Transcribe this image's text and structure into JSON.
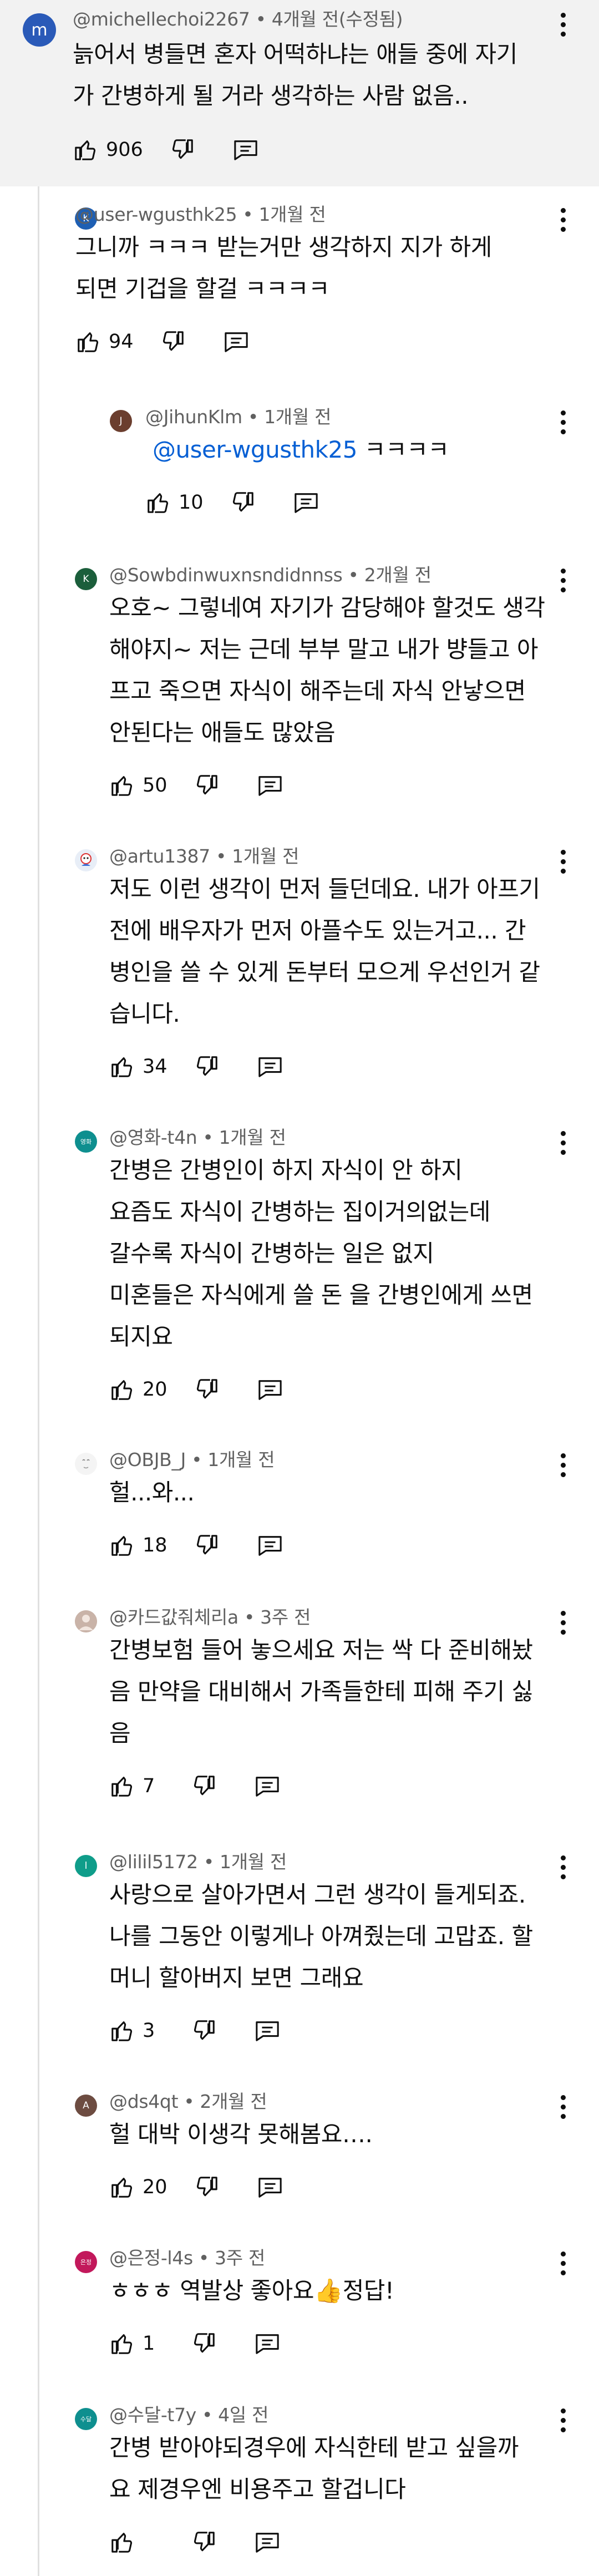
{
  "comments": [
    {
      "author": "@michellechoi2267",
      "time": "4개월 전(수정됨)",
      "lines": [
        "늙어서 병들면 혼자 어떡하냐는 애들 중에 자기",
        "가 간병하게 될 거라 생각하는 사람 없음.."
      ],
      "likes": "906",
      "avatar_letter": "m",
      "avatar_color": "#2a5ab8"
    },
    {
      "author": "@user-wgusthk25",
      "time": "1개월 전",
      "lines": [
        "그니까 ㅋㅋㅋ 받는거만 생각하지 지가 하게",
        "되면 기겁을 할걸 ㅋㅋㅋㅋ"
      ],
      "likes": "94",
      "avatar_letter": "K",
      "avatar_color": "#1e5fb3"
    },
    {
      "author": "@JihunKlm",
      "time": "1개월 전",
      "mention": "@user-wgusthk25",
      "lines": [
        " ㅋㅋㅋㅋ"
      ],
      "likes": "10",
      "avatar_letter": "J",
      "avatar_color": "#6b3e2e"
    },
    {
      "author": "@Sowbdinwuxnsndidnnss",
      "time": "2개월 전",
      "lines": [
        "오호~ 그렇네여 자기가 감당해야 할것도 생각",
        "해야지~ 저는 근데 부부 말고 내가 뱡들고 아",
        "프고 죽으면 자식이 해주는데 자식 안낳으면",
        "안된다는 애들도 많았음"
      ],
      "likes": "50",
      "avatar_letter": "K",
      "avatar_color": "#1b5e3b"
    },
    {
      "author": "@artu1387",
      "time": "1개월 전",
      "lines": [
        "저도 이런 생각이 먼저 들던데요. 내가 아프기",
        "전에 배우자가 먼저 아플수도 있는거고... 간",
        "병인을 쓸 수 있게 돈부터 모으게 우선인거 같",
        "습니다."
      ],
      "likes": "34",
      "avatar_letter": "",
      "avatar_color": "#e8eef7"
    },
    {
      "author": "@영화-t4n",
      "time": "1개월 전",
      "lines": [
        "간병은 간병인이 하지 자식이 안 하지",
        "요즘도 자식이 간병하는 집이거의없는데",
        "갈수록 자식이 간병하는 일은 없지",
        "미혼들은 자식에게 쓸 돈 을  간병인에게 쓰면",
        "되지요"
      ],
      "likes": "20",
      "avatar_letter": "영화",
      "avatar_color": "#0e8f8f"
    },
    {
      "author": "@OBJB_J",
      "time": "1개월 전",
      "lines": [
        "헐...와..."
      ],
      "likes": "18",
      "avatar_letter": "",
      "avatar_color": "#f4f4f4"
    },
    {
      "author": "@카드값줘체리a",
      "time": "3주 전",
      "lines": [
        "간병보험 들어 놓으세요 저는 싹 다 준비해놨",
        "음 만약을 대비해서 가족들한테 피해 주기 싫",
        "음"
      ],
      "likes": "7",
      "avatar_letter": "",
      "avatar_color": "#c9b3a8"
    },
    {
      "author": "@lilil5172",
      "time": "1개월 전",
      "lines": [
        "사랑으로 살아가면서 그런 생각이 들게되죠.",
        "나를 그동안 이렇게나 아껴줬는데 고맙죠. 할",
        "머니 할아버지 보면 그래요"
      ],
      "likes": "3",
      "avatar_letter": "l",
      "avatar_color": "#0f9d8a"
    },
    {
      "author": "@ds4qt",
      "time": "2개월 전",
      "lines": [
        "헐 대박 이생각 못해봄요…."
      ],
      "likes": "20",
      "avatar_letter": "A",
      "avatar_color": "#6d4c41"
    },
    {
      "author": "@은정-l4s",
      "time": "3주 전",
      "lines": [
        "ㅎㅎㅎ 역발상 좋아요👍정답!"
      ],
      "likes": "1",
      "avatar_letter": "은정",
      "avatar_color": "#c2185b"
    },
    {
      "author": "@수달-t7y",
      "time": "4일 전",
      "lines": [
        "간병 받아야되경우에   자식한테 받고 싶을까",
        "요    제경우엔   비용주고  할겁니다"
      ],
      "likes": "",
      "avatar_letter": "수달",
      "avatar_color": "#0e8f8f"
    }
  ],
  "colors": {
    "top_comment_bg": "#f2f2f2",
    "mention": "#065fd4",
    "meta_text": "#606060",
    "thread_line": "#e0e0e0"
  },
  "icons": {
    "like": "thumbs-up-icon",
    "dislike": "thumbs-down-icon",
    "reply": "reply-comment-icon",
    "menu": "more-vertical-icon"
  }
}
